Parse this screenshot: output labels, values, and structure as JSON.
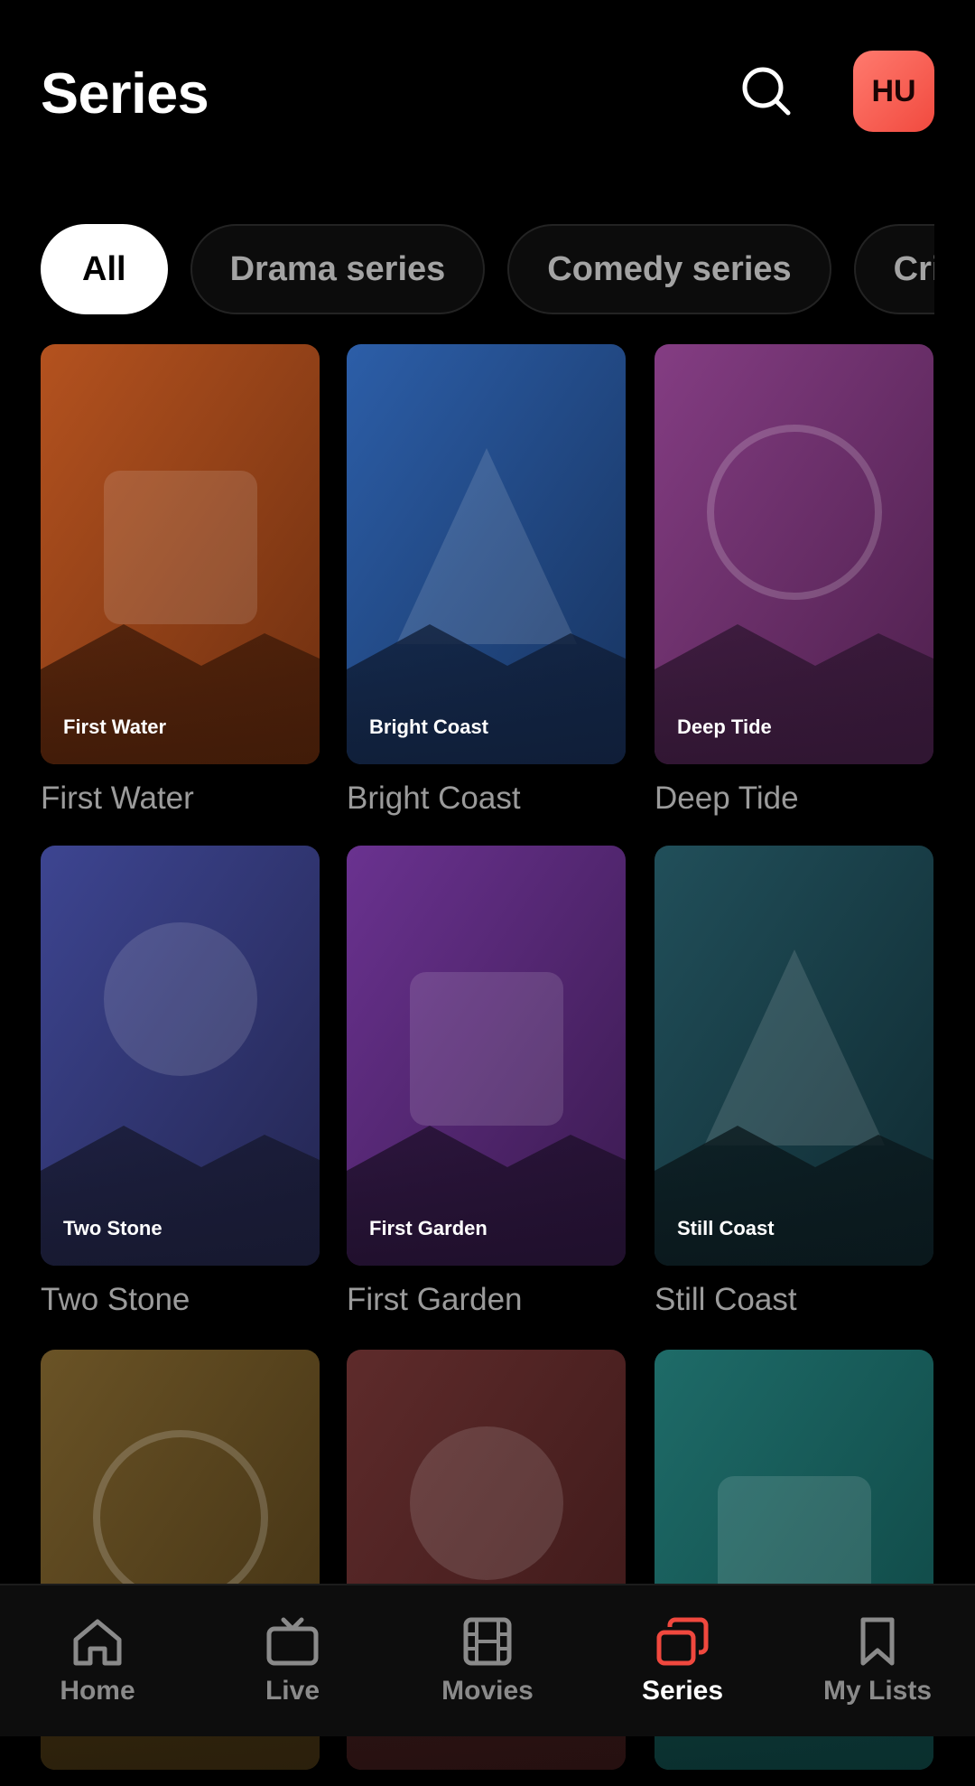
{
  "header": {
    "title": "Series",
    "avatar_initials": "HU"
  },
  "chips": [
    {
      "label": "All",
      "active": true
    },
    {
      "label": "Drama series",
      "active": false
    },
    {
      "label": "Comedy series",
      "active": false
    },
    {
      "label": "Crime series",
      "active": false
    }
  ],
  "cards": [
    {
      "title": "First Water",
      "shape": "square",
      "colors": [
        "#b4521f",
        "#6e2f10"
      ],
      "mountain": "#3e1a08"
    },
    {
      "title": "Bright Coast",
      "shape": "triangle",
      "colors": [
        "#2c5ea8",
        "#17335f"
      ],
      "mountain": "#0f1d36"
    },
    {
      "title": "Deep Tide",
      "shape": "ring",
      "colors": [
        "#843d83",
        "#4d1f4c"
      ],
      "mountain": "#2e1530"
    },
    {
      "title": "Two Stone",
      "shape": "circle",
      "colors": [
        "#3d4591",
        "#232550"
      ],
      "mountain": "#16182e"
    },
    {
      "title": "First Garden",
      "shape": "square",
      "colors": [
        "#6a3290",
        "#3a1a4f"
      ],
      "mountain": "#1e0f2a"
    },
    {
      "title": "Still Coast",
      "shape": "triangle",
      "colors": [
        "#214f5a",
        "#0f2a31"
      ],
      "mountain": "#0a171b"
    },
    {
      "title": "",
      "shape": "ring",
      "colors": [
        "#6a5326",
        "#3f2f12"
      ],
      "mountain": "#2a1f0b"
    },
    {
      "title": "",
      "shape": "circle",
      "colors": [
        "#5e2b2b",
        "#3a1717"
      ],
      "mountain": "#251010"
    },
    {
      "title": "",
      "shape": "square",
      "colors": [
        "#1e6b68",
        "#0e4543"
      ],
      "mountain": "#0a2e2d"
    }
  ],
  "tabs": [
    {
      "label": "Home",
      "icon": "home-icon",
      "active": false
    },
    {
      "label": "Live",
      "icon": "tv-icon",
      "active": false
    },
    {
      "label": "Movies",
      "icon": "film-icon",
      "active": false
    },
    {
      "label": "Series",
      "icon": "series-icon",
      "active": true
    },
    {
      "label": "My Lists",
      "icon": "bookmark-icon",
      "active": false
    }
  ],
  "accent_color": "#f0483e"
}
